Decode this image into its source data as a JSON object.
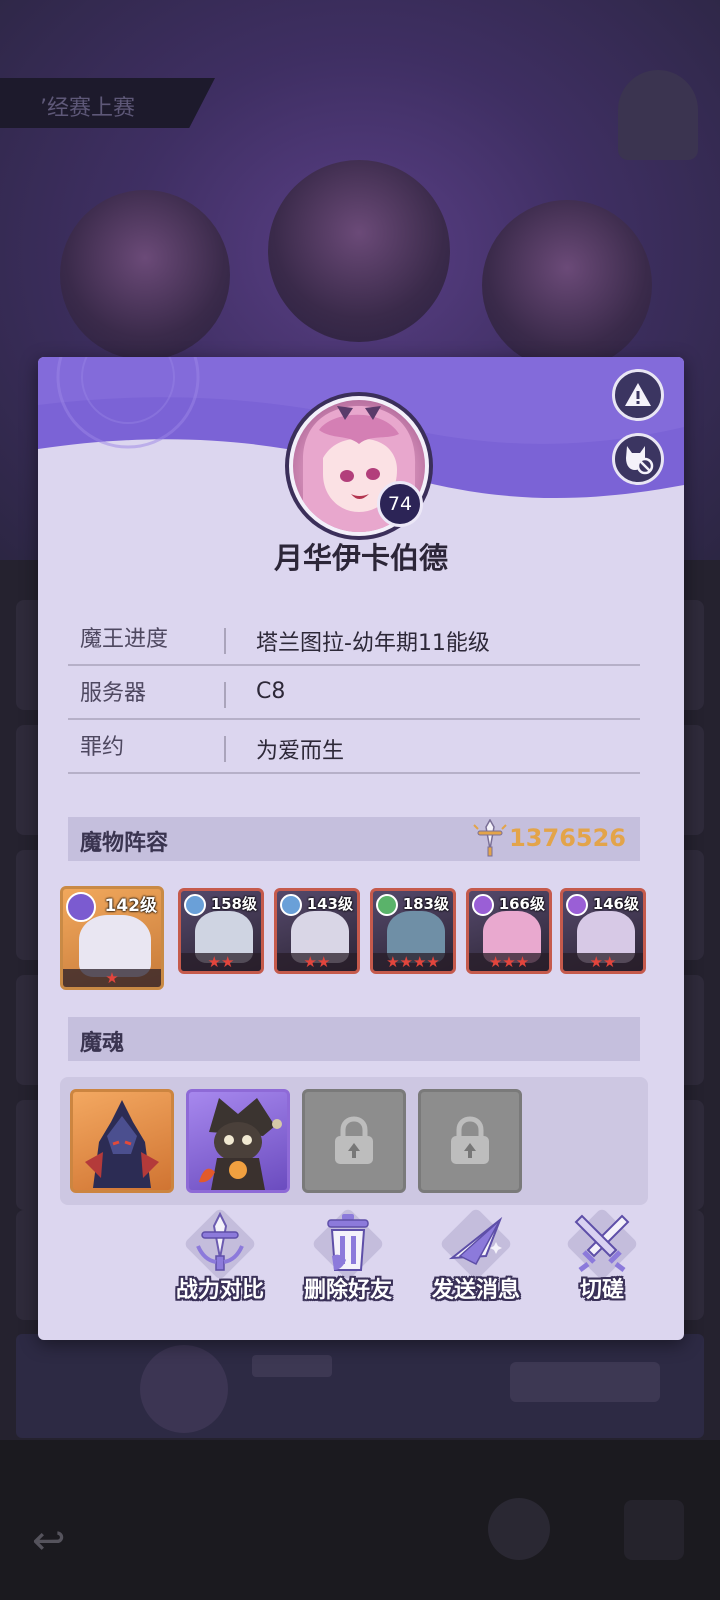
{
  "background": {
    "banner_text": "’经赛上赛"
  },
  "profile": {
    "avatar_level": "74",
    "name": "月华伊卡伯德"
  },
  "header_buttons": {
    "report_icon": "warning-icon",
    "block_icon": "block-cat-icon"
  },
  "info": [
    {
      "label": "魔王进度",
      "value": "塔兰图拉-幼年期11能级"
    },
    {
      "label": "服务器",
      "value": "C8"
    },
    {
      "label": "罪约",
      "value": "为爱而生"
    }
  ],
  "lineup": {
    "title": "魔物阵容",
    "power_icon": "sword-power-icon",
    "power": "1376526",
    "heroes": [
      {
        "level": "142级",
        "stars": 1,
        "faction_color": "#7b5bd0",
        "figure_color": "#e9e6f2"
      },
      {
        "level": "158级",
        "stars": 2,
        "faction_color": "#6aa0d8",
        "figure_color": "#cfd4e2"
      },
      {
        "level": "143级",
        "stars": 2,
        "faction_color": "#6aa0d8",
        "figure_color": "#d9d6e6"
      },
      {
        "level": "183级",
        "stars": 4,
        "faction_color": "#5ab36a",
        "figure_color": "#6f8fa6"
      },
      {
        "level": "166级",
        "stars": 3,
        "faction_color": "#9a5fd6",
        "figure_color": "#e9a9cf"
      },
      {
        "level": "146级",
        "stars": 2,
        "faction_color": "#9a5fd6",
        "figure_color": "#d7c9e6"
      }
    ]
  },
  "souls": {
    "title": "魔魂",
    "slots": [
      {
        "state": "filled",
        "rarity": "orange"
      },
      {
        "state": "filled",
        "rarity": "purple"
      },
      {
        "state": "locked",
        "icon": "lock-icon"
      },
      {
        "state": "locked",
        "icon": "lock-icon"
      }
    ]
  },
  "actions": [
    {
      "label": "战力对比",
      "icon": "compare-power-icon"
    },
    {
      "label": "删除好友",
      "icon": "trash-icon"
    },
    {
      "label": "发送消息",
      "icon": "send-message-icon"
    },
    {
      "label": "切磋",
      "icon": "crossed-swords-icon"
    }
  ],
  "colors": {
    "accent_purple": "#7b63d6",
    "power_gold": "#e3a44a",
    "star_red": "#e2453c"
  }
}
